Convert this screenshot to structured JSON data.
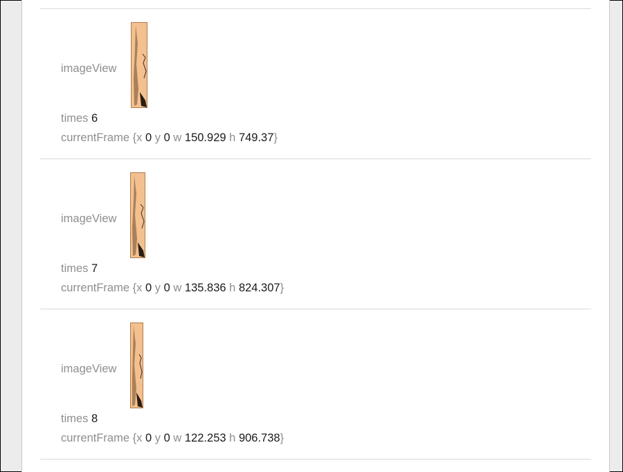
{
  "entries": [
    {
      "image_label": "imageView",
      "times_label": "times",
      "times_value": "6",
      "frame_label": "currentFrame",
      "frame_open": "{x",
      "x_value": "0",
      "y_key": "y",
      "y_value": "0",
      "w_key": "w",
      "w_value": "150.929",
      "h_key": "h",
      "h_value": "749.37",
      "frame_close": "}"
    },
    {
      "image_label": "imageView",
      "times_label": "times",
      "times_value": "7",
      "frame_label": "currentFrame",
      "frame_open": "{x",
      "x_value": "0",
      "y_key": "y",
      "y_value": "0",
      "w_key": "w",
      "w_value": "135.836",
      "h_key": "h",
      "h_value": "824.307",
      "frame_close": "}"
    },
    {
      "image_label": "imageView",
      "times_label": "times",
      "times_value": "8",
      "frame_label": "currentFrame",
      "frame_open": "{x",
      "x_value": "0",
      "y_key": "y",
      "y_value": "0",
      "w_key": "w",
      "w_value": "122.253",
      "h_key": "h",
      "h_value": "906.738",
      "frame_close": "}"
    }
  ],
  "colors": {
    "label": "#8e8e8e",
    "value": "#1a1a1a",
    "separator": "#d9d9d9",
    "thumbnail": "#f0b98a"
  }
}
